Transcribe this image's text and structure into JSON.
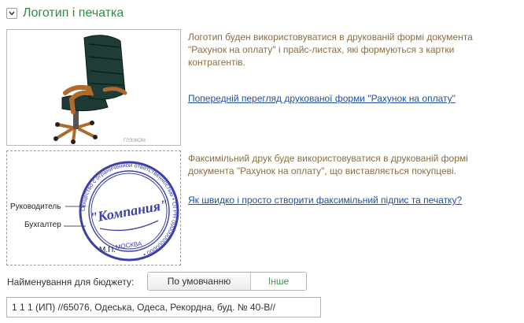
{
  "section": {
    "title": "Логотип і печатка"
  },
  "logo": {
    "description": "Логотип буден використовуватися в друкованій формі документа \"Рахунок на оплату\" і прайс-листах, які формуються з картки контрагентів.",
    "preview_link": "Попередній перегляд друкованої форми \"Рахунок на оплату\"",
    "image_caption": "ГЛЭЗКОМ"
  },
  "stamp": {
    "description": "Факсимільний друк буде використовуватися в друкованій формі документа \"Рахунок на оплату\", що виставляється покупцеві.",
    "howto_link": "Як швидко і просто створити факсимільний підпис та печатку?",
    "label_director": "Руководитель",
    "label_accountant": "Бухгалтер",
    "label_mp": "М.П.",
    "seal_name": "\"Компания\"",
    "seal_ring_text": "Общество с ограниченной ответственностью • ОГРН 0000000000000 •",
    "seal_city": "МОСКВА",
    "seal_color": "#3b3fa8"
  },
  "budget": {
    "label": "Найменування для бюджету:",
    "options": [
      "По умовчанню",
      "Інше"
    ],
    "selected": "Інше"
  },
  "address": {
    "value": "1 1 1 (ИП) //65076, Одеська, Одеса, Рекордна, буд. № 40-В//"
  }
}
